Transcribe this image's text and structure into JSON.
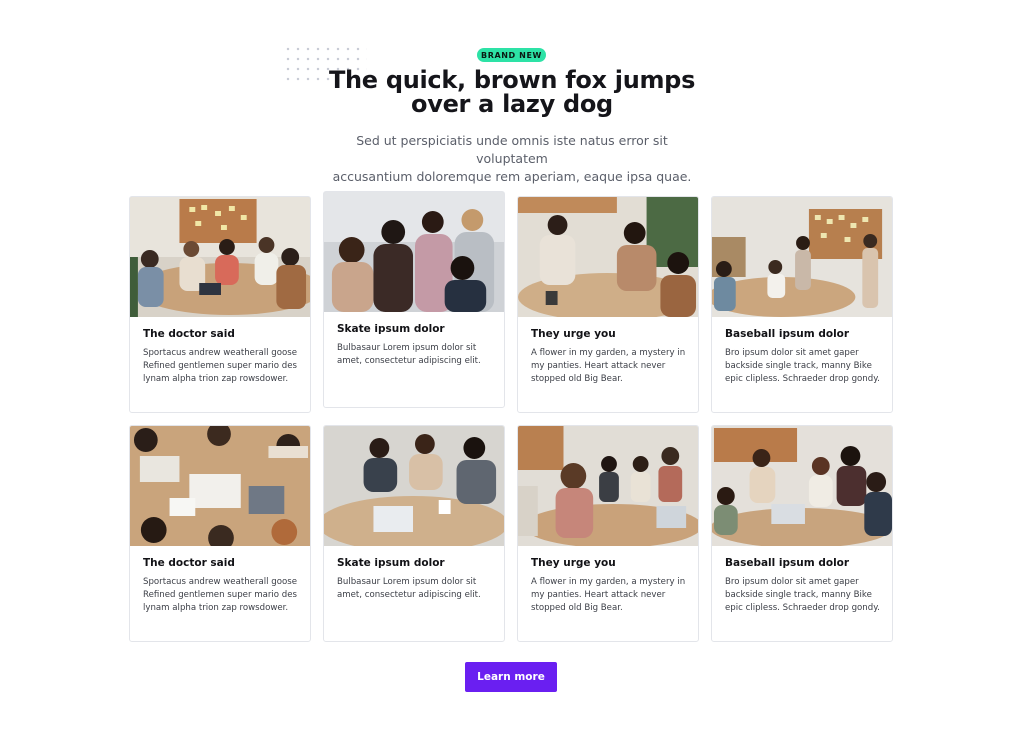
{
  "header": {
    "badge": "BRAND NEW",
    "title_line1": "The quick, brown fox jumps",
    "title_line2": "over a lazy dog",
    "subtitle_line1": "Sed ut perspiciatis unde omnis iste natus error sit voluptatem",
    "subtitle_line2": "accusantium doloremque rem aperiam, eaque ipsa quae."
  },
  "cards": [
    {
      "title": "The doctor said",
      "text": "Sportacus andrew weatherall goose Refined gentlemen super mario des lynam alpha trion zap rowsdower."
    },
    {
      "title": "Skate ipsum dolor",
      "text": "Bulbasaur Lorem ipsum dolor sit amet, consectetur adipiscing elit."
    },
    {
      "title": "They urge you",
      "text": "A flower in my garden, a mystery in my panties. Heart attack never stopped old Big Bear."
    },
    {
      "title": "Baseball ipsum dolor",
      "text": "Bro ipsum dolor sit amet gaper backside single track, manny Bike epic clipless. Schraeder drop gondy."
    },
    {
      "title": "The doctor said",
      "text": "Sportacus andrew weatherall goose Refined gentlemen super mario des lynam alpha trion zap rowsdower."
    },
    {
      "title": "Skate ipsum dolor",
      "text": "Bulbasaur Lorem ipsum dolor sit amet, consectetur adipiscing elit."
    },
    {
      "title": "They urge you",
      "text": "A flower in my garden, a mystery in my panties. Heart attack never stopped old Big Bear."
    },
    {
      "title": "Baseball ipsum dolor",
      "text": "Bro ipsum dolor sit amet gaper backside single track, manny Bike epic clipless. Schraeder drop gondy."
    }
  ],
  "cta": {
    "label": "Learn more"
  },
  "colors": {
    "badge": "#2de2a6",
    "button": "#6a1ff1",
    "title": "#15151a",
    "subtitle": "#5b5f6a"
  }
}
